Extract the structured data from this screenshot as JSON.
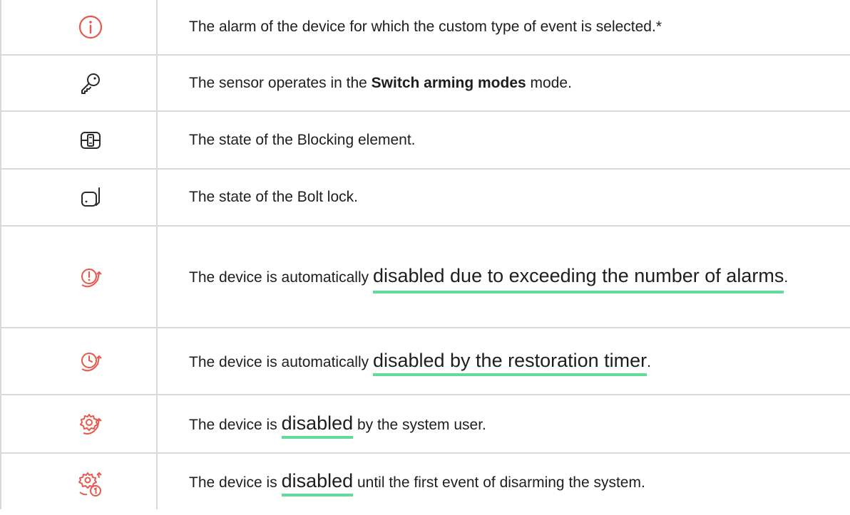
{
  "colors": {
    "accent_red": "#e8584c",
    "link_underline": "#5fdc9a",
    "border": "#d9d9d9"
  },
  "rows": [
    {
      "icon": "info-circle-icon",
      "text": "The alarm of the device for which the custom type of event is selected.*"
    },
    {
      "icon": "key-icon",
      "pre": "The sensor operates in the ",
      "bold": "Switch arming modes",
      "post": " mode."
    },
    {
      "icon": "blocking-element-icon",
      "text": "The state of the Blocking element."
    },
    {
      "icon": "bolt-lock-icon",
      "text": "The state of the Bolt lock."
    },
    {
      "icon": "alarm-disabled-icon",
      "pre": "The device is automatically ",
      "link": "disabled due to exceeding the number of alarms",
      "post": "."
    },
    {
      "icon": "timer-disabled-icon",
      "pre": "The device is automatically ",
      "link": "disabled by the restoration timer",
      "post": "."
    },
    {
      "icon": "gear-disabled-icon",
      "pre": "The device is ",
      "link": "disabled",
      "post": " by the system user."
    },
    {
      "icon": "gear-disarm-disabled-icon",
      "pre": "The device is ",
      "link": "disabled",
      "post": " until the first event of disarming the system."
    }
  ]
}
